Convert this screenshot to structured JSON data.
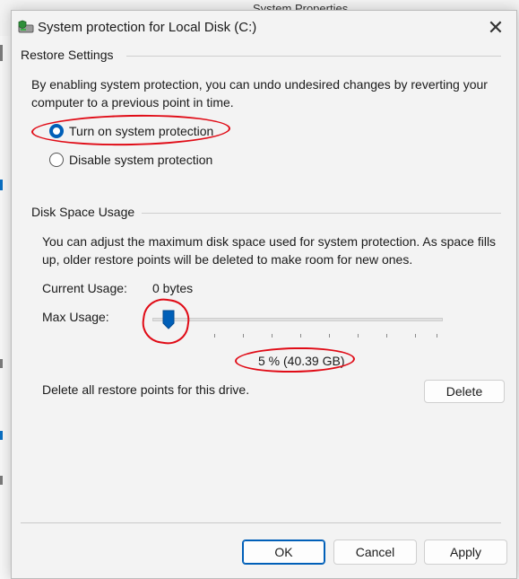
{
  "window": {
    "title": "System protection for Local Disk (C:)",
    "close_glyph": "✕",
    "behind_window_title": "System Properties"
  },
  "restore_settings": {
    "label": "Restore Settings",
    "description": "By enabling system protection, you can undo undesired changes by reverting your computer to a previous point in time.",
    "options": [
      {
        "label": "Turn on system protection",
        "selected": true
      },
      {
        "label": "Disable system protection",
        "selected": false
      }
    ]
  },
  "disk_space": {
    "label": "Disk Space Usage",
    "description": "You can adjust the maximum disk space used for system protection. As space fills up, older restore points will be deleted to make room for new ones.",
    "current_usage_label": "Current Usage:",
    "current_usage_value": "0 bytes",
    "max_usage_label": "Max Usage:",
    "max_usage_percent": 5,
    "max_usage_display": "5 % (40.39 GB)",
    "delete_text": "Delete all restore points for this drive.",
    "delete_button": "Delete"
  },
  "footer": {
    "ok": "OK",
    "cancel": "Cancel",
    "apply": "Apply"
  },
  "colors": {
    "accent": "#005fb8",
    "annotation": "#e00b16"
  },
  "icons": {
    "title": "drive-shield-icon",
    "close": "close-icon",
    "slider": "slider-thumb-icon"
  }
}
